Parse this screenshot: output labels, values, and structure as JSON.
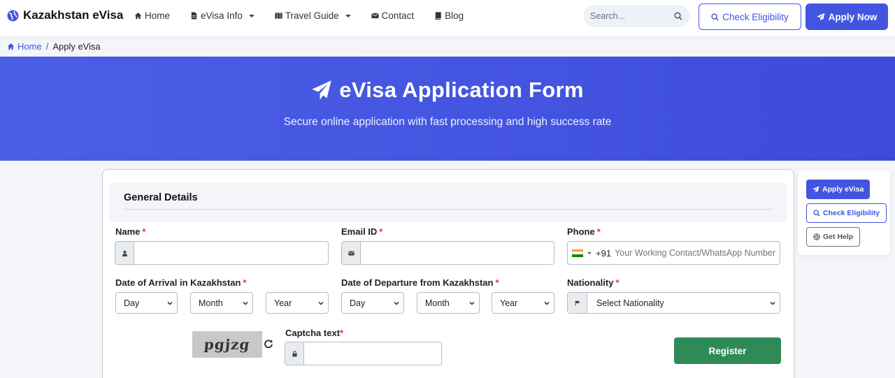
{
  "brand": {
    "name": "Kazakhstan eVisa",
    "icon": "globe-icon"
  },
  "nav": {
    "items": [
      {
        "label": "Home",
        "icon": "home-icon",
        "dropdown": false
      },
      {
        "label": "eVisa Info",
        "icon": "document-icon",
        "dropdown": true
      },
      {
        "label": "Travel Guide",
        "icon": "map-icon",
        "dropdown": true
      },
      {
        "label": "Contact",
        "icon": "envelope-icon",
        "dropdown": false
      },
      {
        "label": "Blog",
        "icon": "book-icon",
        "dropdown": false
      }
    ]
  },
  "search": {
    "placeholder": "Search...",
    "value": ""
  },
  "header_buttons": {
    "check_eligibility": "Check Eligibility",
    "apply_now": "Apply Now"
  },
  "breadcrumb": {
    "home": "Home",
    "separator": "/",
    "current": "Apply eVisa"
  },
  "hero": {
    "title": "eVisa Application Form",
    "subtitle": "Secure online application with fast processing and high success rate"
  },
  "form": {
    "section_title": "General Details",
    "name": {
      "label": "Name",
      "required": "*",
      "value": ""
    },
    "email": {
      "label": "Email ID",
      "required": "*",
      "value": ""
    },
    "phone": {
      "label": "Phone",
      "required": "*",
      "code": "+91",
      "placeholder": "Your Working Contact/WhatsApp Number",
      "value": ""
    },
    "arrival": {
      "label": "Date of Arrival in Kazakhstan",
      "required": "*",
      "day": "Day",
      "month": "Month",
      "year": "Year"
    },
    "departure": {
      "label": "Date of Departure from Kazakhstan",
      "required": "*",
      "day": "Day",
      "month": "Month",
      "year": "Year"
    },
    "nationality": {
      "label": "Nationality",
      "required": "*",
      "selected": "Select Nationality"
    },
    "captcha": {
      "image_text": "pgjzg",
      "label": "Captcha text",
      "required": "*",
      "value": ""
    },
    "register": "Register"
  },
  "side": {
    "apply": "Apply eVisa",
    "check": "Check Eligibility",
    "help": "Get Help"
  },
  "colors": {
    "primary": "#4355e0",
    "success": "#2e8b57",
    "required": "#dc3545"
  }
}
